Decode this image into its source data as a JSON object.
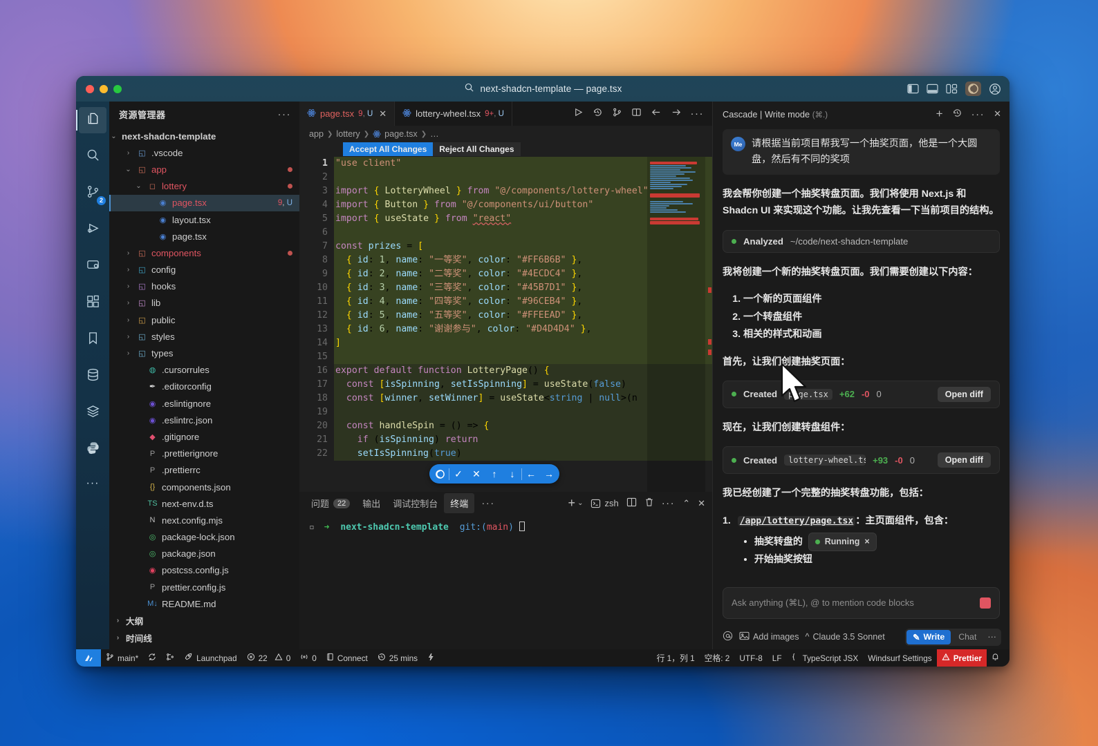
{
  "titlebar": {
    "title": "next-shadcn-template — page.tsx",
    "search_icon": "search-icon",
    "right_icons": [
      "left-panel-icon",
      "bottom-panel-icon",
      "layout-icon",
      "windsurf-icon",
      "account-icon"
    ]
  },
  "activitybar": {
    "items": [
      {
        "name": "explorer",
        "icon": "files-icon",
        "badge": ""
      },
      {
        "name": "search",
        "icon": "search-icon",
        "badge": ""
      },
      {
        "name": "source-control",
        "icon": "source-control-icon",
        "badge": "2"
      },
      {
        "name": "run-and-debug",
        "icon": "run-debug-icon",
        "badge": ""
      },
      {
        "name": "remote-explorer",
        "icon": "remote-icon",
        "badge": ""
      },
      {
        "name": "extensions",
        "icon": "extensions-icon",
        "badge": ""
      },
      {
        "name": "bookmarks",
        "icon": "bookmark-icon",
        "badge": ""
      },
      {
        "name": "database",
        "icon": "database-icon",
        "badge": ""
      },
      {
        "name": "layers",
        "icon": "layers-icon",
        "badge": ""
      },
      {
        "name": "python",
        "icon": "python-icon",
        "badge": ""
      }
    ],
    "more": "···"
  },
  "explorer": {
    "header": "资源管理器",
    "more": "···",
    "root": "next-shadcn-template",
    "items": [
      {
        "label": ".vscode",
        "indent": 1,
        "kind": "folder",
        "chev": "›",
        "icon": "◱",
        "iconColor": "#6a9ad0",
        "modified": false,
        "error": false
      },
      {
        "label": "app",
        "indent": 1,
        "kind": "folder",
        "chev": "⌄",
        "icon": "◱",
        "iconColor": "#cf6f5a",
        "modified": true,
        "error": true
      },
      {
        "label": "lottery",
        "indent": 2,
        "kind": "folder",
        "chev": "⌄",
        "icon": "◻",
        "iconColor": "#cf6f5a",
        "modified": true,
        "error": true
      },
      {
        "label": "page.tsx",
        "indent": 3,
        "kind": "file",
        "chev": "",
        "icon": "◉",
        "iconColor": "#4a7fd0",
        "selected": true,
        "error": true,
        "tag_n": "9",
        "tag_u": "U"
      },
      {
        "label": "layout.tsx",
        "indent": 3,
        "kind": "file",
        "chev": "",
        "icon": "◉",
        "iconColor": "#4a7fd0",
        "modified": false,
        "error": false
      },
      {
        "label": "page.tsx",
        "indent": 3,
        "kind": "file",
        "chev": "",
        "icon": "◉",
        "iconColor": "#4a7fd0",
        "modified": false,
        "error": false
      },
      {
        "label": "components",
        "indent": 1,
        "kind": "folder",
        "chev": "›",
        "icon": "◱",
        "iconColor": "#cf6f5a",
        "modified": true,
        "error": true
      },
      {
        "label": "config",
        "indent": 1,
        "kind": "folder",
        "chev": "›",
        "icon": "◱",
        "iconColor": "#3fa6c9",
        "modified": false,
        "error": false
      },
      {
        "label": "hooks",
        "indent": 1,
        "kind": "folder",
        "chev": "›",
        "icon": "◱",
        "iconColor": "#b07fd0",
        "modified": false,
        "error": false
      },
      {
        "label": "lib",
        "indent": 1,
        "kind": "folder",
        "chev": "›",
        "icon": "◱",
        "iconColor": "#c98fd0",
        "modified": false,
        "error": false
      },
      {
        "label": "public",
        "indent": 1,
        "kind": "folder",
        "chev": "›",
        "icon": "◱",
        "iconColor": "#d0a04a",
        "modified": false,
        "error": false
      },
      {
        "label": "styles",
        "indent": 1,
        "kind": "folder",
        "chev": "›",
        "icon": "◱",
        "iconColor": "#6fb0d0",
        "modified": false,
        "error": false
      },
      {
        "label": "types",
        "indent": 1,
        "kind": "folder",
        "chev": "›",
        "icon": "◱",
        "iconColor": "#6fb0d0",
        "modified": false,
        "error": false
      },
      {
        "label": ".cursorrules",
        "indent": 2,
        "kind": "file",
        "chev": "",
        "icon": "◍",
        "iconColor": "#3fb9a6",
        "modified": false,
        "error": false
      },
      {
        "label": ".editorconfig",
        "indent": 2,
        "kind": "file",
        "chev": "",
        "icon": "✒",
        "iconColor": "#dddddd",
        "modified": false,
        "error": false
      },
      {
        "label": ".eslintignore",
        "indent": 2,
        "kind": "file",
        "chev": "",
        "icon": "◉",
        "iconColor": "#6b4fd0",
        "modified": false,
        "error": false
      },
      {
        "label": ".eslintrc.json",
        "indent": 2,
        "kind": "file",
        "chev": "",
        "icon": "◉",
        "iconColor": "#6b4fd0",
        "modified": false,
        "error": false
      },
      {
        "label": ".gitignore",
        "indent": 2,
        "kind": "file",
        "chev": "",
        "icon": "◆",
        "iconColor": "#e04f6f",
        "modified": false,
        "error": false
      },
      {
        "label": ".prettierignore",
        "indent": 2,
        "kind": "file",
        "chev": "",
        "icon": "P",
        "iconColor": "#9a9a9a",
        "modified": false,
        "error": false
      },
      {
        "label": ".prettierrc",
        "indent": 2,
        "kind": "file",
        "chev": "",
        "icon": "P",
        "iconColor": "#9a9a9a",
        "modified": false,
        "error": false
      },
      {
        "label": "components.json",
        "indent": 2,
        "kind": "file",
        "chev": "",
        "icon": "{}",
        "iconColor": "#d0b04a",
        "modified": false,
        "error": false
      },
      {
        "label": "next-env.d.ts",
        "indent": 2,
        "kind": "file",
        "chev": "",
        "icon": "TS",
        "iconColor": "#4fbf9f",
        "modified": false,
        "error": false
      },
      {
        "label": "next.config.mjs",
        "indent": 2,
        "kind": "file",
        "chev": "",
        "icon": "N",
        "iconColor": "#bdbdbd",
        "modified": false,
        "error": false
      },
      {
        "label": "package-lock.json",
        "indent": 2,
        "kind": "file",
        "chev": "",
        "icon": "◎",
        "iconColor": "#4fbf6f",
        "modified": false,
        "error": false
      },
      {
        "label": "package.json",
        "indent": 2,
        "kind": "file",
        "chev": "",
        "icon": "◎",
        "iconColor": "#4fbf6f",
        "modified": false,
        "error": false
      },
      {
        "label": "postcss.config.js",
        "indent": 2,
        "kind": "file",
        "chev": "",
        "icon": "◉",
        "iconColor": "#e0415f",
        "modified": false,
        "error": false
      },
      {
        "label": "prettier.config.js",
        "indent": 2,
        "kind": "file",
        "chev": "",
        "icon": "P",
        "iconColor": "#9a9a9a",
        "modified": false,
        "error": false
      },
      {
        "label": "README.md",
        "indent": 2,
        "kind": "file",
        "chev": "",
        "icon": "M↓",
        "iconColor": "#4a8fd0",
        "modified": false,
        "error": false
      }
    ],
    "sections": [
      {
        "label": "大纲",
        "chev": "›"
      },
      {
        "label": "时间线",
        "chev": "›"
      }
    ]
  },
  "editor": {
    "tabs": [
      {
        "name": "page.tsx",
        "tag_n": "9",
        "tag_u": "U",
        "active": true,
        "closable": true
      },
      {
        "name": "lottery-wheel.tsx",
        "tag_n": "9+",
        "tag_u": "U",
        "active": false,
        "closable": false
      }
    ],
    "tab_actions": [
      "run-icon",
      "history-icon",
      "source-control-graph-icon",
      "split-editor-icon",
      "back-arrow-icon",
      "forward-arrow-icon",
      "more-icon"
    ],
    "breadcrumb": [
      "app",
      "lottery",
      "page.tsx",
      "…"
    ],
    "accept_all": "Accept All Changes",
    "reject_all": "Reject All Changes",
    "diff_toolbar": [
      "windsurf-icon",
      "accept-check-icon",
      "reject-x-icon",
      "prev-up-icon",
      "next-down-icon",
      "left-arrow-icon",
      "right-arrow-icon"
    ],
    "lines": [
      {
        "n": 1,
        "added": true,
        "text": "\"use client\""
      },
      {
        "n": 2,
        "added": true,
        "text": ""
      },
      {
        "n": 3,
        "added": true,
        "text": "import { LotteryWheel } from \"@/components/lottery-wheel\""
      },
      {
        "n": 4,
        "added": true,
        "text": "import { Button } from \"@/components/ui/button\""
      },
      {
        "n": 5,
        "added": true,
        "text": "import { useState } from \"react\""
      },
      {
        "n": 6,
        "added": true,
        "text": ""
      },
      {
        "n": 7,
        "added": true,
        "text": "const prizes = ["
      },
      {
        "n": 8,
        "added": true,
        "text": "  { id: 1, name: \"一等奖\", color: \"#FF6B6B\" },"
      },
      {
        "n": 9,
        "added": true,
        "text": "  { id: 2, name: \"二等奖\", color: \"#4ECDC4\" },"
      },
      {
        "n": 10,
        "added": true,
        "text": "  { id: 3, name: \"三等奖\", color: \"#45B7D1\" },"
      },
      {
        "n": 11,
        "added": true,
        "text": "  { id: 4, name: \"四等奖\", color: \"#96CEB4\" },"
      },
      {
        "n": 12,
        "added": true,
        "text": "  { id: 5, name: \"五等奖\", color: \"#FFEEAD\" },"
      },
      {
        "n": 13,
        "added": true,
        "text": "  { id: 6, name: \"谢谢参与\", color: \"#D4D4D4\" },"
      },
      {
        "n": 14,
        "added": true,
        "text": "]"
      },
      {
        "n": 15,
        "added": true,
        "text": ""
      },
      {
        "n": 16,
        "added": true,
        "text": "export default function LotteryPage() {"
      },
      {
        "n": 17,
        "added": true,
        "text": "  const [isSpinning, setIsSpinning] = useState(false)"
      },
      {
        "n": 18,
        "added": true,
        "text": "  const [winner, setWinner] = useState<string | null>(n"
      },
      {
        "n": 19,
        "added": true,
        "text": ""
      },
      {
        "n": 20,
        "added": true,
        "text": "  const handleSpin = () => {"
      },
      {
        "n": 21,
        "added": true,
        "text": "    if (isSpinning) return"
      },
      {
        "n": 22,
        "added": true,
        "text": "    setIsSpinning(true)"
      }
    ]
  },
  "panel": {
    "tabs": [
      {
        "label": "问题",
        "count": "22",
        "active": false
      },
      {
        "label": "输出",
        "count": "",
        "active": false
      },
      {
        "label": "调试控制台",
        "count": "",
        "active": false
      },
      {
        "label": "终端",
        "count": "",
        "active": true
      }
    ],
    "more": "···",
    "actions": {
      "add": "+",
      "chevron": "⌄",
      "shell": "zsh",
      "split_icon": "split-terminal-icon",
      "trash_icon": "kill-terminal-icon",
      "more_icon": "more-icon",
      "collapse_icon": "collapse-panel-icon",
      "close_icon": "close-panel-icon"
    },
    "terminal": {
      "prompt_symbol": "➜",
      "dir": "next-shadcn-template",
      "git_label": "git:(",
      "branch": "main",
      "git_close": ")"
    }
  },
  "cascade": {
    "title": "Cascade | Write mode",
    "shortcut": "(⌘.)",
    "header_icons": [
      "new-conversation-icon",
      "history-icon",
      "more-icon",
      "close-icon"
    ],
    "user": {
      "avatar_label": "Me",
      "message": "请根据当前项目帮我写一个抽奖页面，他是一个大圆盘，然后有不同的奖项"
    },
    "assistant_1": "我会帮你创建一个抽奖转盘页面。我们将使用 Next.js 和 Shadcn UI 来实现这个功能。让我先查看一下当前项目的结构。",
    "tool_analyzed": {
      "verb": "Analyzed",
      "path": "~/code/next-shadcn-template"
    },
    "assistant_2": "我将创建一个新的抽奖转盘页面。我们需要创建以下内容：",
    "list_1": [
      "一个新的页面组件",
      "一个转盘组件",
      "相关的样式和动画"
    ],
    "assistant_3": "首先，让我们创建抽奖页面：",
    "tool_created_1": {
      "verb": "Created",
      "file": "page.tsx",
      "added": "+62",
      "removed": "-0",
      "other": "0",
      "action": "Open diff"
    },
    "assistant_4": "现在，让我们创建转盘组件：",
    "tool_created_2": {
      "verb": "Created",
      "file": "lottery-wheel.tsx",
      "added": "+93",
      "removed": "-0",
      "other": "0",
      "action": "Open diff"
    },
    "assistant_5": "我已经创建了一个完整的抽奖转盘功能，包括：",
    "list_2_num": "1.",
    "list_2_link": "/app/lottery/page.tsx",
    "list_2_text": "：主页面组件，包含：",
    "sub_items": [
      "抽奖转盘的",
      "开始抽奖按钮"
    ],
    "running_badge": {
      "label": "Running",
      "close": "×"
    },
    "input_placeholder": "Ask anything (⌘L), @ to mention code blocks",
    "footer": {
      "at_icon": "mention-icon",
      "images_icon": "image-icon",
      "add_images": "Add images",
      "model_chevron": "^",
      "model": "Claude 3.5 Sonnet",
      "mode_write": "Write",
      "mode_chat": "Chat",
      "more": "···"
    }
  },
  "statusbar": {
    "logo_icon": "windsurf-logo-icon",
    "left": [
      {
        "icon": "branch-icon",
        "label": "main*"
      },
      {
        "icon": "sync-icon",
        "label": ""
      },
      {
        "icon": "remote-icon",
        "label": ""
      },
      {
        "icon": "rocket-icon",
        "label": "Launchpad"
      },
      {
        "icon": "error-icon",
        "label": "22"
      },
      {
        "icon": "warning-icon",
        "label": "0"
      },
      {
        "icon": "radio-tower-icon",
        "label": "0"
      },
      {
        "icon": "port-icon",
        "label": "Connect"
      },
      {
        "icon": "clock-icon",
        "label": "25 mins"
      },
      {
        "icon": "zap-icon",
        "label": ""
      }
    ],
    "right": [
      {
        "label": "行 1，列 1"
      },
      {
        "label": "空格: 2"
      },
      {
        "label": "UTF-8"
      },
      {
        "label": "LF"
      },
      {
        "label": "TypeScript JSX",
        "icon": "braces-icon"
      },
      {
        "label": "Windsurf Settings"
      },
      {
        "label": "Prettier",
        "icon": "warning-icon",
        "highlight": "#d62828"
      },
      {
        "label": "",
        "icon": "bell-icon"
      }
    ]
  }
}
